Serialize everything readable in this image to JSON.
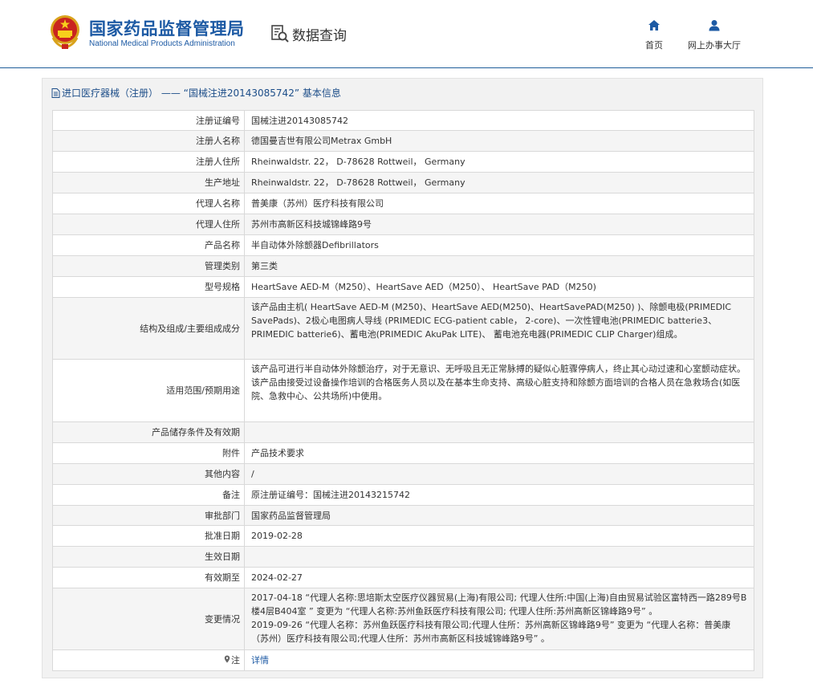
{
  "header": {
    "logo_cn": "国家药品监督管理局",
    "logo_en": "National Medical Products Administration",
    "query_label": "数据查询",
    "nav_home": "首页",
    "nav_hall": "网上办事大厅"
  },
  "panel": {
    "title": "进口医疗器械（注册） —— “国械注进20143085742” 基本信息"
  },
  "rows": [
    {
      "label": "注册证编号",
      "value": "国械注进20143085742"
    },
    {
      "label": "注册人名称",
      "value": "德国曼吉世有限公司Metrax GmbH"
    },
    {
      "label": "注册人住所",
      "value": "Rheinwaldstr. 22， D-78628 Rottweil， Germany"
    },
    {
      "label": "生产地址",
      "value": "Rheinwaldstr. 22， D-78628 Rottweil， Germany"
    },
    {
      "label": "代理人名称",
      "value": "普美康（苏州）医疗科技有限公司"
    },
    {
      "label": "代理人住所",
      "value": "苏州市高新区科技城锦峰路9号"
    },
    {
      "label": "产品名称",
      "value": "半自动体外除颤器Defibrillators"
    },
    {
      "label": "管理类别",
      "value": "第三类"
    },
    {
      "label": "型号规格",
      "value": "HeartSave AED-M（M250）、HeartSave AED（M250）、 HeartSave PAD（M250)"
    },
    {
      "label": "结构及组成/主要组成成分",
      "value": "该产品由主机( HeartSave AED-M (M250)、HeartSave AED(M250)、HeartSavePAD(M250) )、除颤电极(PRIMEDIC SavePads)、2极心电图病人导线 (PRIMEDIC ECG-patient cable， 2-core)、一次性锂电池(PRIMEDIC batterie3、 PRIMEDIC batterie6)、蓄电池(PRIMEDIC AkuPak LITE)、 蓄电池充电器(PRIMEDIC CLIP Charger)组成。"
    },
    {
      "label": "适用范围/预期用途",
      "value": "该产品可进行半自动体外除颤治疗，对于无意识、无呼吸且无正常脉搏的疑似心脏骤停病人，终止其心动过速和心室颤动症状。该产品由接受过设备操作培训的合格医务人员以及在基本生命支持、高级心脏支持和除颤方面培训的合格人员在急救场合(如医院、急救中心、公共场所)中使用。"
    },
    {
      "label": "产品储存条件及有效期",
      "value": ""
    },
    {
      "label": "附件",
      "value": "产品技术要求"
    },
    {
      "label": "其他内容",
      "value": "/"
    },
    {
      "label": "备注",
      "value": "原注册证编号：国械注进20143215742"
    },
    {
      "label": "审批部门",
      "value": "国家药品监督管理局"
    },
    {
      "label": "批准日期",
      "value": "2019-02-28"
    },
    {
      "label": "生效日期",
      "value": ""
    },
    {
      "label": "有效期至",
      "value": "2024-02-27"
    },
    {
      "label": "变更情况",
      "value": "2017-04-18 “代理人名称:思培斯太空医疗仪器贸易(上海)有限公司; 代理人住所:中国(上海)自由贸易试验区富特西一路289号B楼4层B404室 ” 变更为 “代理人名称:苏州鱼跃医疗科技有限公司; 代理人住所:苏州高新区锦峰路9号” 。\n2019-09-26 “代理人名称：苏州鱼跃医疗科技有限公司;代理人住所：苏州高新区锦峰路9号” 变更为 “代理人名称：普美康（苏州）医疗科技有限公司;代理人住所：苏州市高新区科技城锦峰路9号” 。"
    }
  ],
  "note_row": {
    "label": "注",
    "value": "详情"
  },
  "colors": {
    "brand_blue": "#1d5aa4",
    "header_line": "#1f5d9a",
    "border": "#d9d9d9"
  }
}
